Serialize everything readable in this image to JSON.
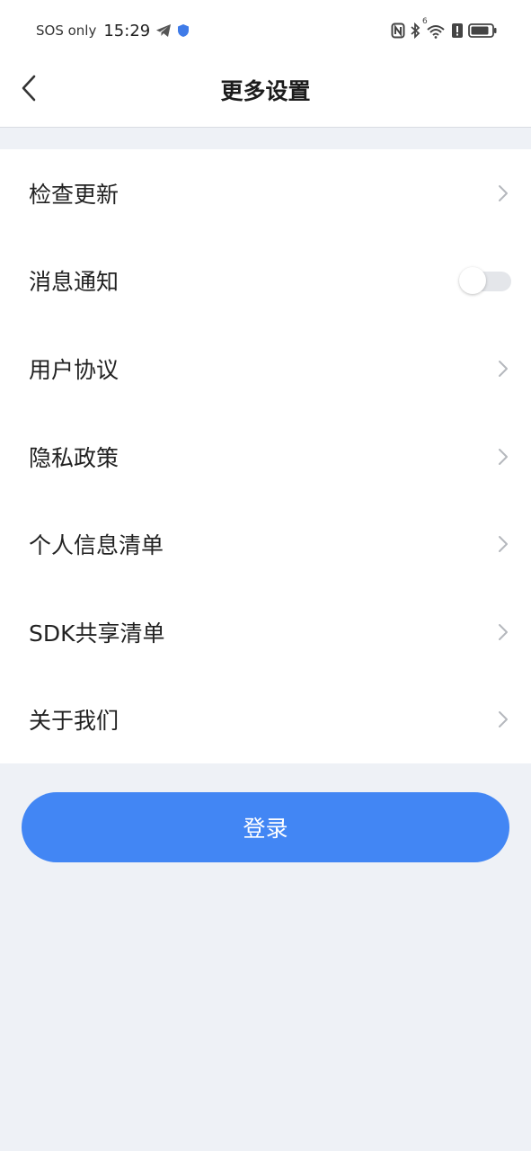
{
  "status_bar": {
    "carrier": "SOS only",
    "time": "15:29",
    "network_label": "6"
  },
  "header": {
    "title": "更多设置"
  },
  "menu": {
    "items": [
      {
        "label": "检查更新",
        "control": "chevron"
      },
      {
        "label": "消息通知",
        "control": "toggle",
        "enabled": false
      },
      {
        "label": "用户协议",
        "control": "chevron"
      },
      {
        "label": "隐私政策",
        "control": "chevron"
      },
      {
        "label": "个人信息清单",
        "control": "chevron"
      },
      {
        "label": "SDK共享清单",
        "control": "chevron"
      },
      {
        "label": "关于我们",
        "control": "chevron"
      }
    ]
  },
  "actions": {
    "login_label": "登录"
  },
  "colors": {
    "accent": "#4286f4",
    "page_background": "#eef1f6",
    "card_background": "#ffffff"
  }
}
